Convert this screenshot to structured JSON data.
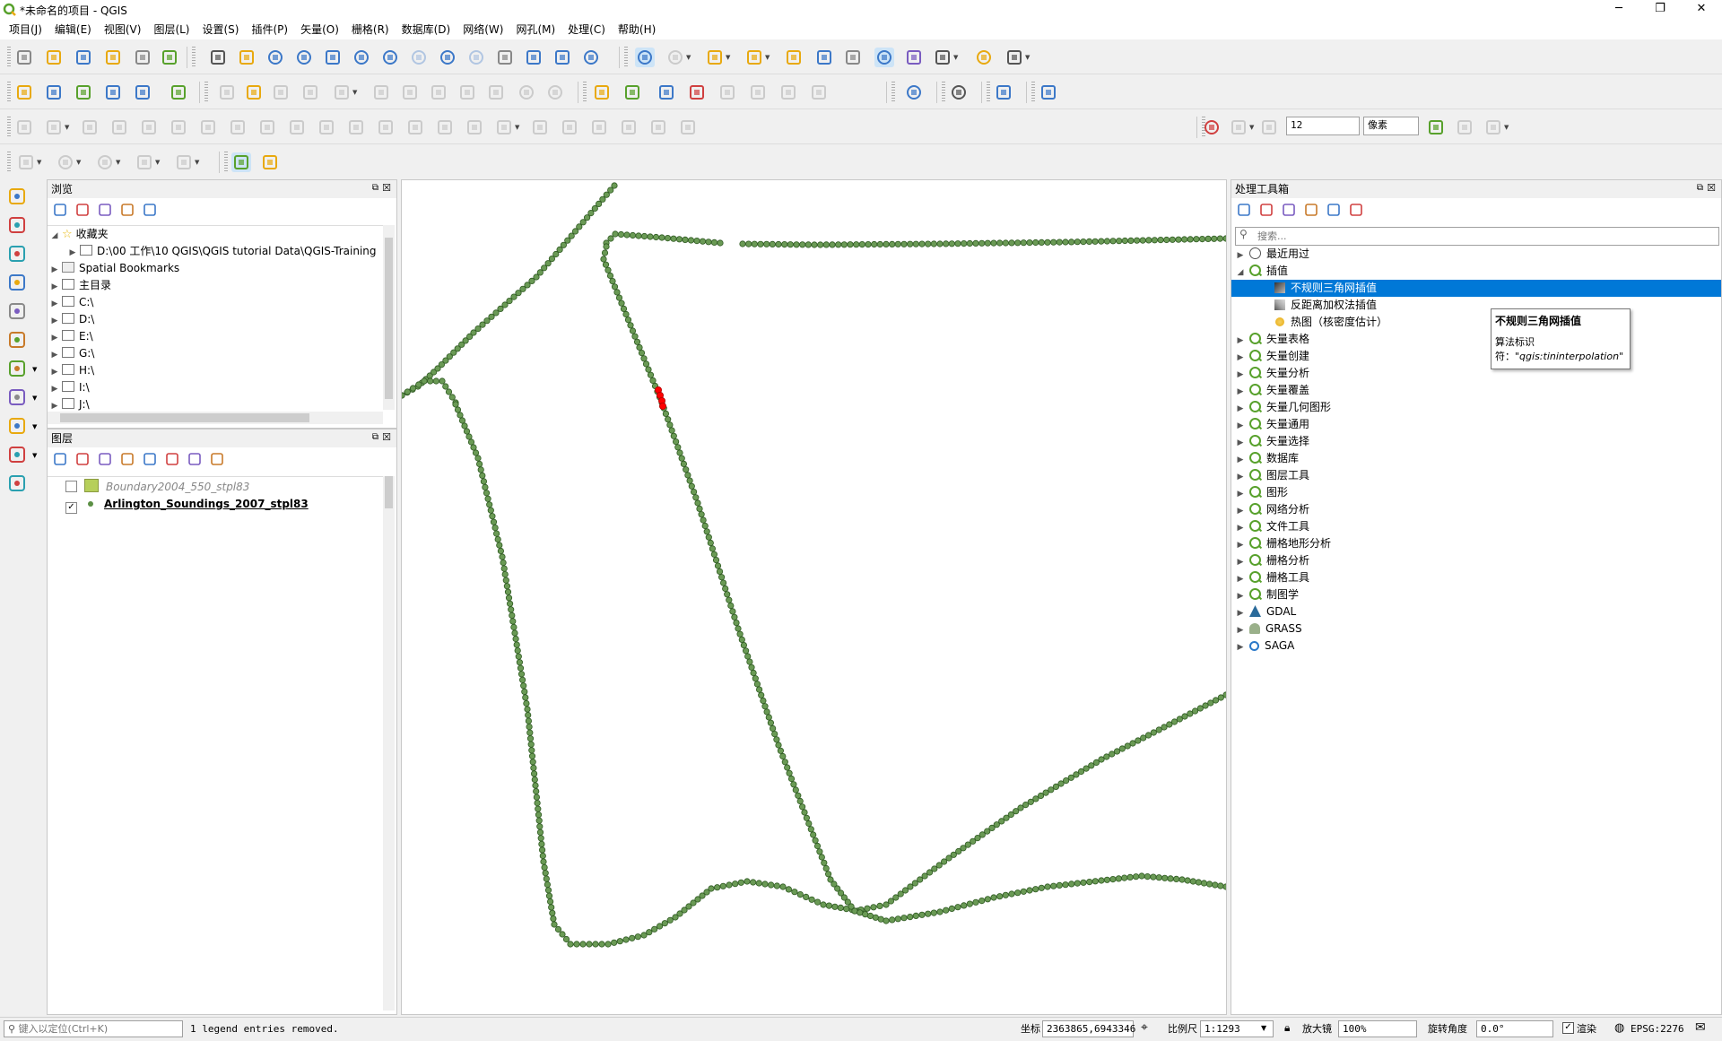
{
  "window": {
    "title": "*未命名的项目 - QGIS",
    "minimize": "─",
    "maximize": "❐",
    "close": "✕"
  },
  "menu": [
    "项目(J)",
    "编辑(E)",
    "视图(V)",
    "图层(L)",
    "设置(S)",
    "插件(P)",
    "矢量(O)",
    "栅格(R)",
    "数据库(D)",
    "网络(W)",
    "网孔(M)",
    "处理(C)",
    "帮助(H)"
  ],
  "snapping": {
    "tolerance": "12",
    "unit": "像素"
  },
  "browser": {
    "title": "浏览",
    "items": [
      {
        "label": "收藏夹",
        "level": 0,
        "expanded": true
      },
      {
        "label": "D:\\00 工作\\10 QGIS\\QGIS tutorial Data\\QGIS-Training",
        "level": 1,
        "expanded": false
      },
      {
        "label": "Spatial Bookmarks",
        "level": 0,
        "expanded": false
      },
      {
        "label": "主目录",
        "level": 0,
        "expanded": false
      },
      {
        "label": "C:\\",
        "level": 0,
        "expanded": false
      },
      {
        "label": "D:\\",
        "level": 0,
        "expanded": false
      },
      {
        "label": "E:\\",
        "level": 0,
        "expanded": false
      },
      {
        "label": "G:\\",
        "level": 0,
        "expanded": false
      },
      {
        "label": "H:\\",
        "level": 0,
        "expanded": false
      },
      {
        "label": "I:\\",
        "level": 0,
        "expanded": false
      },
      {
        "label": "J:\\",
        "level": 0,
        "expanded": false
      }
    ]
  },
  "layers": {
    "title": "图层",
    "items": [
      {
        "name": "Boundary2004_550_stpl83",
        "checked": false,
        "symbol_color": "#b6cf5a"
      },
      {
        "name": "Arlington_Soundings_2007_stpl83",
        "checked": true,
        "symbol_color": "#5b8f44"
      }
    ]
  },
  "map": {
    "point_color": "#6a9a55",
    "selected_color": "#ff0000"
  },
  "toolbox": {
    "title": "处理工具箱",
    "search_placeholder": "搜索...",
    "items": [
      {
        "label": "最近用过",
        "level": 0,
        "icon": "clock-icon"
      },
      {
        "label": "插值",
        "level": 0,
        "icon": "qgis-icon",
        "expanded": true
      },
      {
        "label": "不规则三角网插值",
        "level": 1,
        "icon": "tin-icon",
        "selected": true
      },
      {
        "label": "反距离加权法插值",
        "level": 1,
        "icon": "idw-icon"
      },
      {
        "label": "热图（核密度估计）",
        "level": 1,
        "icon": "heatmap-icon"
      },
      {
        "label": "矢量表格",
        "level": 0,
        "icon": "qgis-icon"
      },
      {
        "label": "矢量创建",
        "level": 0,
        "icon": "qgis-icon"
      },
      {
        "label": "矢量分析",
        "level": 0,
        "icon": "qgis-icon"
      },
      {
        "label": "矢量覆盖",
        "level": 0,
        "icon": "qgis-icon"
      },
      {
        "label": "矢量几何图形",
        "level": 0,
        "icon": "qgis-icon"
      },
      {
        "label": "矢量通用",
        "level": 0,
        "icon": "qgis-icon"
      },
      {
        "label": "矢量选择",
        "level": 0,
        "icon": "qgis-icon"
      },
      {
        "label": "数据库",
        "level": 0,
        "icon": "qgis-icon"
      },
      {
        "label": "图层工具",
        "level": 0,
        "icon": "qgis-icon"
      },
      {
        "label": "图形",
        "level": 0,
        "icon": "qgis-icon"
      },
      {
        "label": "网络分析",
        "level": 0,
        "icon": "qgis-icon"
      },
      {
        "label": "文件工具",
        "level": 0,
        "icon": "qgis-icon"
      },
      {
        "label": "栅格地形分析",
        "level": 0,
        "icon": "qgis-icon"
      },
      {
        "label": "栅格分析",
        "level": 0,
        "icon": "qgis-icon"
      },
      {
        "label": "栅格工具",
        "level": 0,
        "icon": "qgis-icon"
      },
      {
        "label": "制图学",
        "level": 0,
        "icon": "qgis-icon"
      },
      {
        "label": "GDAL",
        "level": 0,
        "icon": "gdal-icon"
      },
      {
        "label": "GRASS",
        "level": 0,
        "icon": "grass-icon"
      },
      {
        "label": "SAGA",
        "level": 0,
        "icon": "saga-icon"
      }
    ],
    "tooltip": {
      "title": "不规则三角网插值",
      "line1": "算法标识",
      "line2_prefix": "符：",
      "line2_value": "\"qgis:tininterpolation\""
    }
  },
  "status": {
    "locator_placeholder": "键入以定位(Ctrl+K)",
    "message": "1 legend entries removed.",
    "coord_label": "坐标",
    "coord_value": "2363865,6943346",
    "scale_label": "比例尺",
    "scale_value": "1:1293",
    "magnifier_label": "放大镜",
    "magnifier_value": "100%",
    "rotation_label": "旋转角度",
    "rotation_value": "0.0°",
    "render_label": "渲染",
    "crs": "EPSG:2276"
  }
}
